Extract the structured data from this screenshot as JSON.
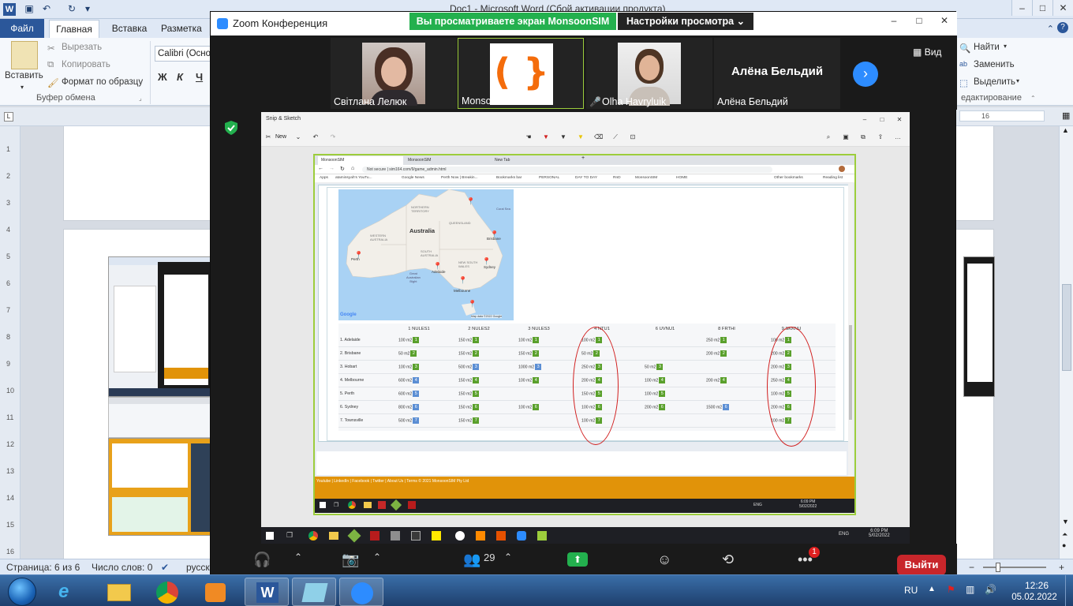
{
  "word": {
    "doc_title": "Doc1 - Microsoft Word (Сбой активации продукта)",
    "tabs": {
      "file": "Файл",
      "home": "Главная",
      "insert": "Вставка",
      "layout": "Разметка"
    },
    "clipboard": {
      "paste": "Вставить",
      "cut": "Вырезать",
      "copy": "Копировать",
      "format_painter": "Формат по образцу",
      "group": "Буфер обмена"
    },
    "font": {
      "name": "Calibri (Осно",
      "bold": "Ж",
      "italic": "К",
      "underline": "Ч"
    },
    "editing": {
      "find": "Найти",
      "replace": "Заменить",
      "select": "Выделить",
      "group": "едактирование"
    },
    "ruler_right": "16",
    "status": {
      "page": "Страница: 6 из 6",
      "words": "Число слов: 0",
      "lang": "русск"
    },
    "vruler_numbers": [
      "1",
      "2",
      "3",
      "4",
      "5",
      "6",
      "7",
      "8",
      "9",
      "10",
      "11",
      "12",
      "13",
      "14",
      "15",
      "16"
    ]
  },
  "zoom": {
    "title": "Zoom Конференция",
    "share_banner": "Вы просматриваете экран MonsoonSIM",
    "view_options": "Настройки просмотра",
    "view_button": "Вид",
    "participants": [
      {
        "name": "Світлана Лелюк"
      },
      {
        "name": "MonsoonSIM"
      },
      {
        "name": "Olha Havryluik"
      },
      {
        "name": "Алёна Бельдий"
      }
    ],
    "toolbar": {
      "participants_count": "29",
      "chat_badge": "1",
      "end_button": "Выйти"
    },
    "logo_glyph": "( }"
  },
  "snip": {
    "title": "Snip & Sketch",
    "new_label": "New",
    "browser": {
      "tabs": [
        "MonsoonSIM",
        "MonsoonSIM",
        "New Tab"
      ],
      "url": "Not secure  |  sim164.com/9/game_admin.html",
      "bookmarks": [
        "Apps",
        "ataminsyah's YouTu...",
        "Google News",
        "Perth Now | Breakin...",
        "Bookmarks bar",
        "PERSONAL",
        "DAY TO DAY",
        "RnD",
        "MonsoonSIM",
        "HOME",
        "Other bookmarks",
        "Reading list"
      ],
      "map_labels": {
        "country": "Australia",
        "nt": "NORTHERN\nTERRITORY",
        "qld": "QUEENSLAND",
        "wa": "WESTERN\nAUSTRALIA",
        "sa": "SOUTH\nAUSTRALIA",
        "nsw": "NEW SOUTH\nWALES",
        "coral": "Coral Sea",
        "bight": "Great\nAustralian\nBight",
        "cities": {
          "perth": "Perth",
          "adelaide": "Adelaide",
          "melbourne": "Melbourne",
          "brisbane": "Brisbane",
          "sydney": "Sydney"
        },
        "google": "Google",
        "mapdata": "Map data ©2022 Google"
      },
      "table": {
        "columns": [
          "1 NULES1",
          "2 NULES2",
          "3 NULES3",
          "4 NTU1",
          "6 UVNU1",
          "8 FRTHI",
          "9 SKKNU"
        ],
        "rows": [
          {
            "label": "1. Adelaide",
            "cells": [
              [
                "100 m2",
                "1",
                "g"
              ],
              [
                "150 m2",
                "1",
                "g"
              ],
              [
                "100 m2",
                "1",
                "g"
              ],
              [
                "100 m2",
                "1",
                "g"
              ],
              null,
              [
                "250 m2",
                "1",
                "g"
              ],
              [
                "100 m2",
                "1",
                "g"
              ]
            ]
          },
          {
            "label": "2. Brisbane",
            "cells": [
              [
                "50 m2",
                "2",
                "g"
              ],
              [
                "150 m2",
                "2",
                "g"
              ],
              [
                "150 m2",
                "2",
                "g"
              ],
              [
                "50 m2",
                "2",
                "g"
              ],
              null,
              [
                "200 m2",
                "2",
                "g"
              ],
              [
                "200 m2",
                "2",
                "g"
              ]
            ]
          },
          {
            "label": "3. Hobart",
            "cells": [
              [
                "100 m2",
                "3",
                "g"
              ],
              [
                "500 m2",
                "3",
                "b"
              ],
              [
                "1000 m2",
                "3",
                "b"
              ],
              [
                "250 m2",
                "3",
                "g"
              ],
              [
                "50 m2",
                "3",
                "g"
              ],
              null,
              [
                "200 m2",
                "3",
                "g"
              ]
            ]
          },
          {
            "label": "4. Melbourne",
            "cells": [
              [
                "600 m2",
                "4",
                "b"
              ],
              [
                "150 m2",
                "4",
                "g"
              ],
              [
                "100 m2",
                "4",
                "g"
              ],
              [
                "200 m2",
                "4",
                "g"
              ],
              [
                "100 m2",
                "4",
                "g"
              ],
              [
                "200 m2",
                "4",
                "g"
              ],
              [
                "250 m2",
                "4",
                "g"
              ]
            ]
          },
          {
            "label": "5. Perth",
            "cells": [
              [
                "600 m2",
                "5",
                "b"
              ],
              [
                "150 m2",
                "5",
                "g"
              ],
              null,
              [
                "150 m2",
                "5",
                "g"
              ],
              [
                "100 m2",
                "5",
                "g"
              ],
              null,
              [
                "100 m2",
                "5",
                "g"
              ]
            ]
          },
          {
            "label": "6. Sydney",
            "cells": [
              [
                "800 m2",
                "6",
                "b"
              ],
              [
                "150 m2",
                "6",
                "g"
              ],
              [
                "100 m2",
                "6",
                "g"
              ],
              [
                "100 m2",
                "6",
                "g"
              ],
              [
                "200 m2",
                "6",
                "g"
              ],
              [
                "1500 m2",
                "6",
                "b"
              ],
              [
                "200 m2",
                "6",
                "g"
              ]
            ]
          },
          {
            "label": "7. Townsville",
            "cells": [
              [
                "500 m2",
                "7",
                "b"
              ],
              [
                "150 m2",
                "7",
                "g"
              ],
              null,
              [
                "100 m2",
                "7",
                "g"
              ],
              null,
              null,
              [
                "100 m2",
                "7",
                "g"
              ]
            ]
          }
        ]
      },
      "footer": "Youtube  |  LinkedIn  |  Facebook  |  Twitter  |  About Us  |  Terms  © 2021 MonsoonSIM Pty Ltd"
    },
    "inner_clock": {
      "time": "6:09 PM",
      "date": "5/02/2022"
    },
    "taskbar_lang": "ENG"
  },
  "taskbar": {
    "lang": "RU",
    "time": "12:26",
    "date": "05.02.2022"
  },
  "colors": {
    "zoom_green": "#23b04e",
    "zoom_blue": "#2d8cff",
    "end_red": "#c8262b",
    "monsoon_orange": "#e19309",
    "annotation_red": "#d11e1e"
  }
}
